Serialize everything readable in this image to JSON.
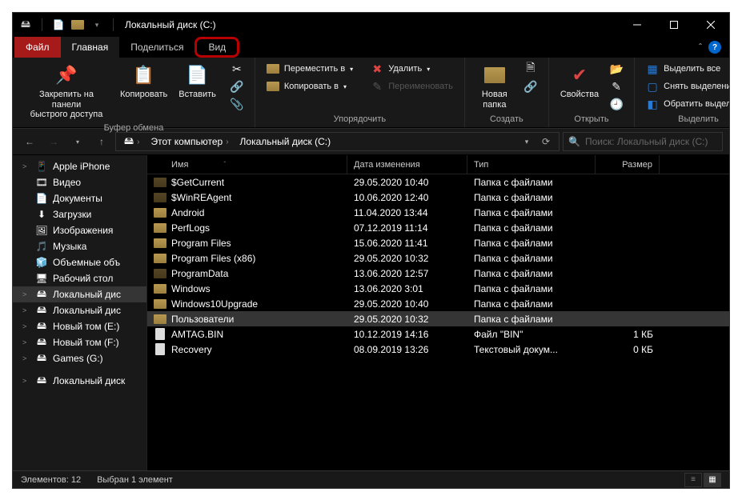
{
  "title": "Локальный диск (C:)",
  "tabs": {
    "file": "Файл",
    "home": "Главная",
    "share": "Поделиться",
    "view": "Вид"
  },
  "ribbon": {
    "clipboard": {
      "pin": "Закрепить на панели\nбыстрого доступа",
      "copy": "Копировать",
      "paste": "Вставить",
      "label": "Буфер обмена"
    },
    "organize": {
      "move": "Переместить в",
      "copyto": "Копировать в",
      "delete": "Удалить",
      "rename": "Переименовать",
      "label": "Упорядочить"
    },
    "create": {
      "newfolder": "Новая\nпапка",
      "label": "Создать"
    },
    "open": {
      "props": "Свойства",
      "label": "Открыть"
    },
    "select": {
      "all": "Выделить все",
      "none": "Снять выделение",
      "invert": "Обратить выделение",
      "label": "Выделить"
    }
  },
  "breadcrumb": {
    "pc": "Этот компьютер",
    "disk": "Локальный диск (C:)"
  },
  "search_placeholder": "Поиск: Локальный диск (C:)",
  "sidebar": [
    {
      "label": "Apple iPhone",
      "icon": "phone",
      "expand": ">"
    },
    {
      "label": "Видео",
      "icon": "video"
    },
    {
      "label": "Документы",
      "icon": "doc"
    },
    {
      "label": "Загрузки",
      "icon": "down"
    },
    {
      "label": "Изображения",
      "icon": "img"
    },
    {
      "label": "Музыка",
      "icon": "music"
    },
    {
      "label": "Объемные объ",
      "icon": "3d"
    },
    {
      "label": "Рабочий стол",
      "icon": "desk"
    },
    {
      "label": "Локальный дис",
      "icon": "drive",
      "expand": ">",
      "selected": true
    },
    {
      "label": "Локальный дис",
      "icon": "drive",
      "expand": ">"
    },
    {
      "label": "Новый том (E:)",
      "icon": "drive",
      "expand": ">"
    },
    {
      "label": "Новый том (F:)",
      "icon": "drive",
      "expand": ">"
    },
    {
      "label": "Games (G:)",
      "icon": "drive",
      "expand": ">"
    },
    {
      "label": "Локальный диск",
      "icon": "drive",
      "expand": ">"
    }
  ],
  "columns": {
    "name": "Имя",
    "date": "Дата изменения",
    "type": "Тип",
    "size": "Размер"
  },
  "files": [
    {
      "name": "$GetCurrent",
      "date": "29.05.2020 10:40",
      "type": "Папка с файлами",
      "size": "",
      "icon": "folder-dim"
    },
    {
      "name": "$WinREAgent",
      "date": "10.06.2020 12:40",
      "type": "Папка с файлами",
      "size": "",
      "icon": "folder-dim"
    },
    {
      "name": "Android",
      "date": "11.04.2020 13:44",
      "type": "Папка с файлами",
      "size": "",
      "icon": "folder"
    },
    {
      "name": "PerfLogs",
      "date": "07.12.2019 11:14",
      "type": "Папка с файлами",
      "size": "",
      "icon": "folder"
    },
    {
      "name": "Program Files",
      "date": "15.06.2020 11:41",
      "type": "Папка с файлами",
      "size": "",
      "icon": "folder"
    },
    {
      "name": "Program Files (x86)",
      "date": "29.05.2020 10:32",
      "type": "Папка с файлами",
      "size": "",
      "icon": "folder"
    },
    {
      "name": "ProgramData",
      "date": "13.06.2020 12:57",
      "type": "Папка с файлами",
      "size": "",
      "icon": "folder-dim"
    },
    {
      "name": "Windows",
      "date": "13.06.2020 3:01",
      "type": "Папка с файлами",
      "size": "",
      "icon": "folder"
    },
    {
      "name": "Windows10Upgrade",
      "date": "29.05.2020 10:40",
      "type": "Папка с файлами",
      "size": "",
      "icon": "folder"
    },
    {
      "name": "Пользователи",
      "date": "29.05.2020 10:32",
      "type": "Папка с файлами",
      "size": "",
      "icon": "folder",
      "selected": true
    },
    {
      "name": "AMTAG.BIN",
      "date": "10.12.2019 14:16",
      "type": "Файл \"BIN\"",
      "size": "1 КБ",
      "icon": "file"
    },
    {
      "name": "Recovery",
      "date": "08.09.2019 13:26",
      "type": "Текстовый докум...",
      "size": "0 КБ",
      "icon": "file"
    }
  ],
  "status": {
    "count": "Элементов: 12",
    "selected": "Выбран 1 элемент"
  }
}
